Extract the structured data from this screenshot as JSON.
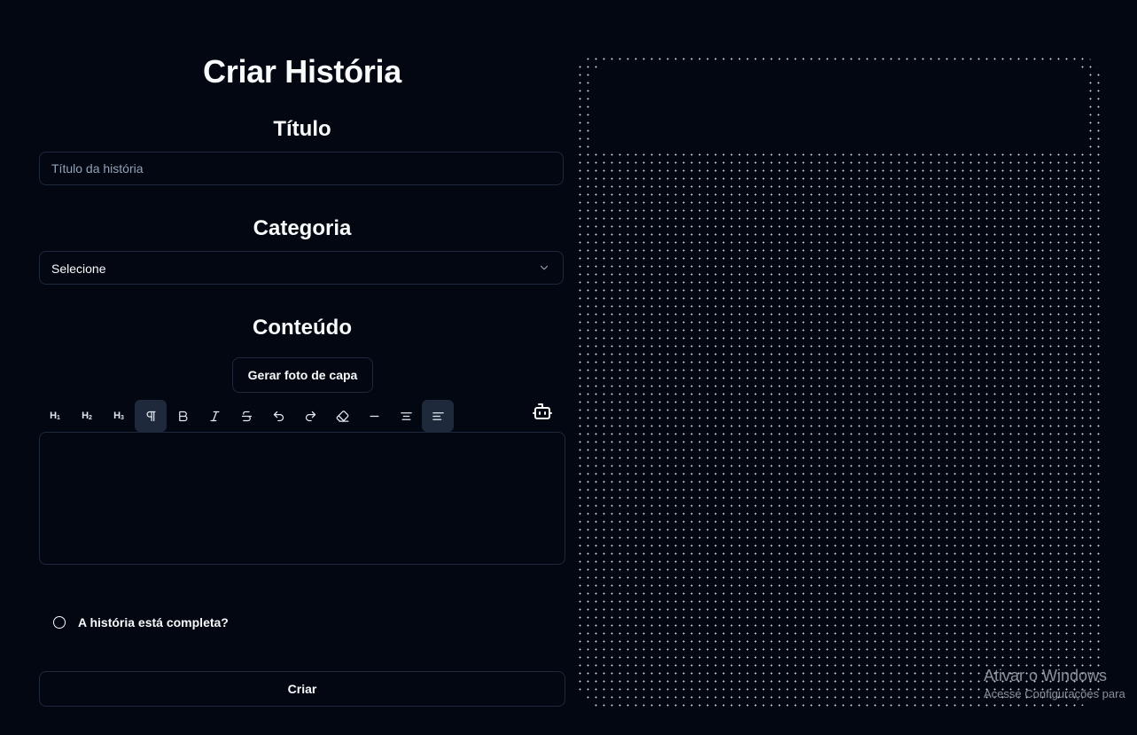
{
  "page": {
    "title": "Criar História"
  },
  "form": {
    "title_section": {
      "label": "Título",
      "placeholder": "Título da história",
      "value": ""
    },
    "category_section": {
      "label": "Categoria",
      "selected": "Selecione"
    },
    "content_section": {
      "label": "Conteúdo",
      "cover_button": "Gerar foto de capa",
      "toolbar": [
        {
          "name": "heading-1",
          "label": "H",
          "sub": "1",
          "active": false
        },
        {
          "name": "heading-2",
          "label": "H",
          "sub": "2",
          "active": false
        },
        {
          "name": "heading-3",
          "label": "H",
          "sub": "3",
          "active": false
        },
        {
          "name": "paragraph",
          "icon": "pilcrow-icon",
          "active": true
        },
        {
          "name": "bold",
          "icon": "bold-icon",
          "active": false
        },
        {
          "name": "italic",
          "icon": "italic-icon",
          "active": false
        },
        {
          "name": "strikethrough",
          "icon": "strikethrough-icon",
          "active": false
        },
        {
          "name": "undo",
          "icon": "undo-icon",
          "active": false
        },
        {
          "name": "redo",
          "icon": "redo-icon",
          "active": false
        },
        {
          "name": "clear-format",
          "icon": "eraser-icon",
          "active": false
        },
        {
          "name": "horizontal-rule",
          "icon": "minus-icon",
          "active": false
        },
        {
          "name": "align-center",
          "icon": "align-center-icon",
          "active": false
        },
        {
          "name": "align-left",
          "icon": "align-left-icon",
          "active": true
        }
      ],
      "ai_icon": "bot-icon",
      "editor_content": ""
    },
    "complete_label": "A história está completa?",
    "complete_checked": false,
    "submit_label": "Criar"
  },
  "watermark": {
    "title": "Ativar o Windows",
    "subtitle": "Acesse Configurações para"
  },
  "colors": {
    "background": "#030711",
    "border": "#1e293b",
    "text": "#f8fafc",
    "muted": "#94a3b8",
    "active_button": "#1e293b"
  }
}
